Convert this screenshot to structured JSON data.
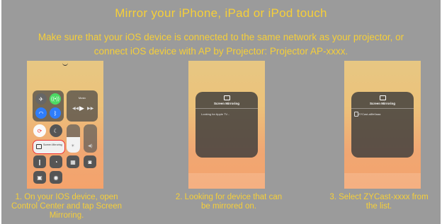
{
  "header": {
    "title": "Mirror your iPhone, iPad or iPod touch",
    "subtitle_line1": "Make sure that your iOS device is connected to the same network as your projector, or",
    "subtitle_line2": "connect iOS device with AP by Projector: Projector AP-xxxx."
  },
  "steps": [
    {
      "caption_line1": "1. On your IOS device, open",
      "caption_line2": "Control Center and tap Screen",
      "caption_line3": "Mirroring."
    },
    {
      "caption_line1": "2. Looking for device that can",
      "caption_line2": "be mirrored on."
    },
    {
      "caption_line1": "3. Select ZYCast-xxxx from",
      "caption_line2": "the list."
    }
  ],
  "screens": {
    "control_center": {
      "music_label": "Music",
      "screen_mirroring_label": "Screen Mirroring"
    },
    "popup_searching": {
      "title": "Screen Mirroring",
      "status": "Looking for Apple TV..."
    },
    "popup_select": {
      "title": "Screen Mirroring",
      "device": "ZYCast-a8fe0aaa"
    }
  },
  "colors": {
    "accent_yellow": "#f6cf38",
    "panel_gray": "#9b9b9b"
  }
}
